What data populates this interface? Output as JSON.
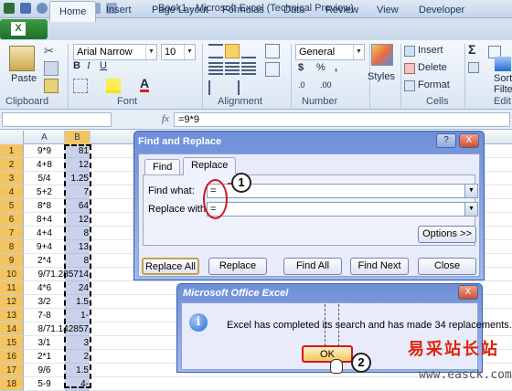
{
  "window": {
    "title": "Book1 - Microsoft Excel (Technical Preview)"
  },
  "ribbon": {
    "file_button": "X",
    "tabs": [
      "Home",
      "Insert",
      "Page Layout",
      "Formulas",
      "Data",
      "Review",
      "View",
      "Developer"
    ],
    "active_tab": "Home",
    "clipboard": {
      "paste_label": "Paste",
      "group_label": "Clipboard"
    },
    "font": {
      "name": "Arial Narrow",
      "size": "10",
      "group_label": "Font",
      "size_up": "A",
      "size_down": "A",
      "bold": "B",
      "italic": "I",
      "underline": "U",
      "font_color_letter": "A"
    },
    "alignment": {
      "group_label": "Alignment"
    },
    "number": {
      "format": "General",
      "currency": "$",
      "percent": "%",
      "comma": ",",
      "group_label": "Number",
      "dec_inc": ".0",
      "dec_dec": ".00"
    },
    "styles": {
      "label": "Styles"
    },
    "cells": {
      "insert_label": "Insert",
      "delete_label": "Delete",
      "format_label": "Format",
      "group_label": "Cells"
    },
    "editing": {
      "sigma": "Σ",
      "sort_label": "Sort",
      "filter_label": "Filte",
      "group_label": "Edit"
    }
  },
  "formula_bar": {
    "fx": "fx",
    "content": "=9*9"
  },
  "grid": {
    "columns": [
      "A",
      "B"
    ],
    "rows": [
      {
        "n": "1",
        "a": "9*9",
        "b": "81"
      },
      {
        "n": "2",
        "a": "4+8",
        "b": "12"
      },
      {
        "n": "3",
        "a": "5/4",
        "b": "1.25"
      },
      {
        "n": "4",
        "a": "5+2",
        "b": "7"
      },
      {
        "n": "5",
        "a": "8*8",
        "b": "64"
      },
      {
        "n": "6",
        "a": "8+4",
        "b": "12"
      },
      {
        "n": "7",
        "a": "4+4",
        "b": "8"
      },
      {
        "n": "8",
        "a": "9+4",
        "b": "13"
      },
      {
        "n": "9",
        "a": "2*4",
        "b": "8"
      },
      {
        "n": "10",
        "a": "9/7",
        "b": "1.285714"
      },
      {
        "n": "11",
        "a": "4*6",
        "b": "24"
      },
      {
        "n": "12",
        "a": "3/2",
        "b": "1.5"
      },
      {
        "n": "13",
        "a": "7-8",
        "b": "-1"
      },
      {
        "n": "14",
        "a": "8/7",
        "b": "1.142857"
      },
      {
        "n": "15",
        "a": "3/1",
        "b": "3"
      },
      {
        "n": "16",
        "a": "2*1",
        "b": "2"
      },
      {
        "n": "17",
        "a": "9/6",
        "b": "1.5"
      },
      {
        "n": "18",
        "a": "5-9",
        "b": "-4"
      }
    ]
  },
  "find_replace": {
    "title": "Find and Replace",
    "tabs": [
      "Find",
      "Replace"
    ],
    "find_label": "Find what:",
    "find_value": "=",
    "replace_label": "Replace with:",
    "replace_value": "=",
    "options_button": "Options >>",
    "buttons": {
      "replace_all": "Replace All",
      "replace": "Replace",
      "find_all": "Find All",
      "find_next": "Find Next",
      "close": "Close"
    },
    "help": "?",
    "close_x": "X"
  },
  "message_box": {
    "title": "Microsoft Office Excel",
    "text": "Excel has completed its search and has made 34 replacements.",
    "ok_button": "OK",
    "close_x": "X",
    "icon_glyph": "i"
  },
  "annotations": {
    "callout1": "1",
    "callout2": "2"
  },
  "watermark": {
    "line1": "易采站长站",
    "line2": "www.easck.com"
  }
}
